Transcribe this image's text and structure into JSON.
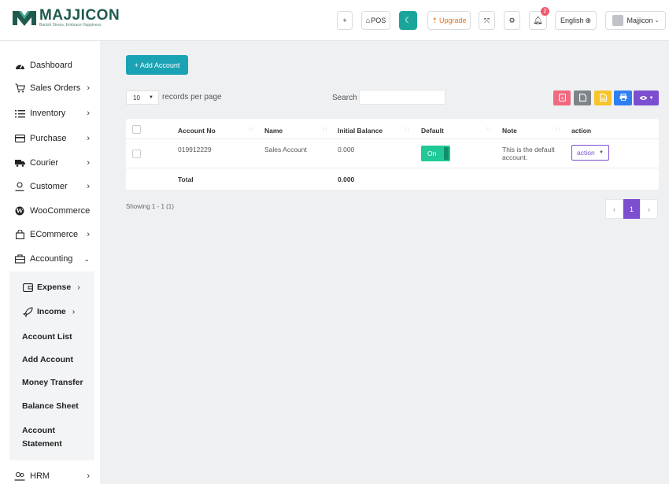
{
  "brand": {
    "name": "MAJJICON",
    "tagline": "Banish Stress, Embrace Happiness",
    "primary_color": "#1f5a4f",
    "accent_color": "#1aa3b4"
  },
  "header": {
    "plus_label": "+",
    "pos_label": "POS",
    "upgrade_label": "Upgrade",
    "notification_count": "2",
    "language_label": "English",
    "user_name": "Majjicon"
  },
  "sidebar": {
    "items": [
      {
        "label": "Dashboard",
        "icon": "dashboard-icon",
        "has_chevron": false
      },
      {
        "label": "Sales Orders",
        "icon": "cart-icon",
        "has_chevron": true
      },
      {
        "label": "Inventory",
        "icon": "list-icon",
        "has_chevron": true
      },
      {
        "label": "Purchase",
        "icon": "card-icon",
        "has_chevron": true
      },
      {
        "label": "Courier",
        "icon": "truck-icon",
        "has_chevron": true
      },
      {
        "label": "Customer",
        "icon": "user-icon",
        "has_chevron": true
      },
      {
        "label": "WooCommerce",
        "icon": "wordpress-icon",
        "has_chevron": false
      },
      {
        "label": "ECommerce",
        "icon": "bag-icon",
        "has_chevron": true
      },
      {
        "label": "Accounting",
        "icon": "briefcase-icon",
        "has_chevron": true,
        "expanded": true
      },
      {
        "label": "HRM",
        "icon": "users-icon",
        "has_chevron": true
      }
    ],
    "accounting_submenu": [
      {
        "label": "Expense",
        "icon": "wallet-icon",
        "has_chevron": true
      },
      {
        "label": "Income",
        "icon": "rocket-icon",
        "has_chevron": true
      },
      {
        "label": "Account List"
      },
      {
        "label": "Add Account"
      },
      {
        "label": "Money Transfer"
      },
      {
        "label": "Balance Sheet"
      },
      {
        "label": "Account Statement"
      }
    ]
  },
  "main": {
    "add_button_label": "+ Add Account",
    "page_length": "10",
    "records_label": "records per page",
    "search_label": "Search",
    "search_value": "",
    "export_buttons": [
      {
        "name": "pdf-export-button",
        "color": "#f1697f"
      },
      {
        "name": "csv-export-button",
        "color": "#7f8489"
      },
      {
        "name": "excel-export-button",
        "color": "#f8c42b"
      },
      {
        "name": "print-button",
        "color": "#2f7ff1"
      },
      {
        "name": "column-visibility-button",
        "color": "#7b4fd0"
      }
    ],
    "table": {
      "columns": [
        "Account No",
        "Name",
        "Initial Balance",
        "Default",
        "Note",
        "action"
      ],
      "rows": [
        {
          "account_no": "019912229",
          "name": "Sales Account",
          "initial_balance": "0.000",
          "default_label": "On",
          "note": "This is the default account.",
          "action_label": "action"
        }
      ],
      "footer": {
        "label": "Total",
        "initial_balance": "0.000"
      }
    },
    "showing_text": "Showing 1 - 1 (1)",
    "pagination": {
      "prev": "‹",
      "current": "1",
      "next": "›"
    }
  }
}
